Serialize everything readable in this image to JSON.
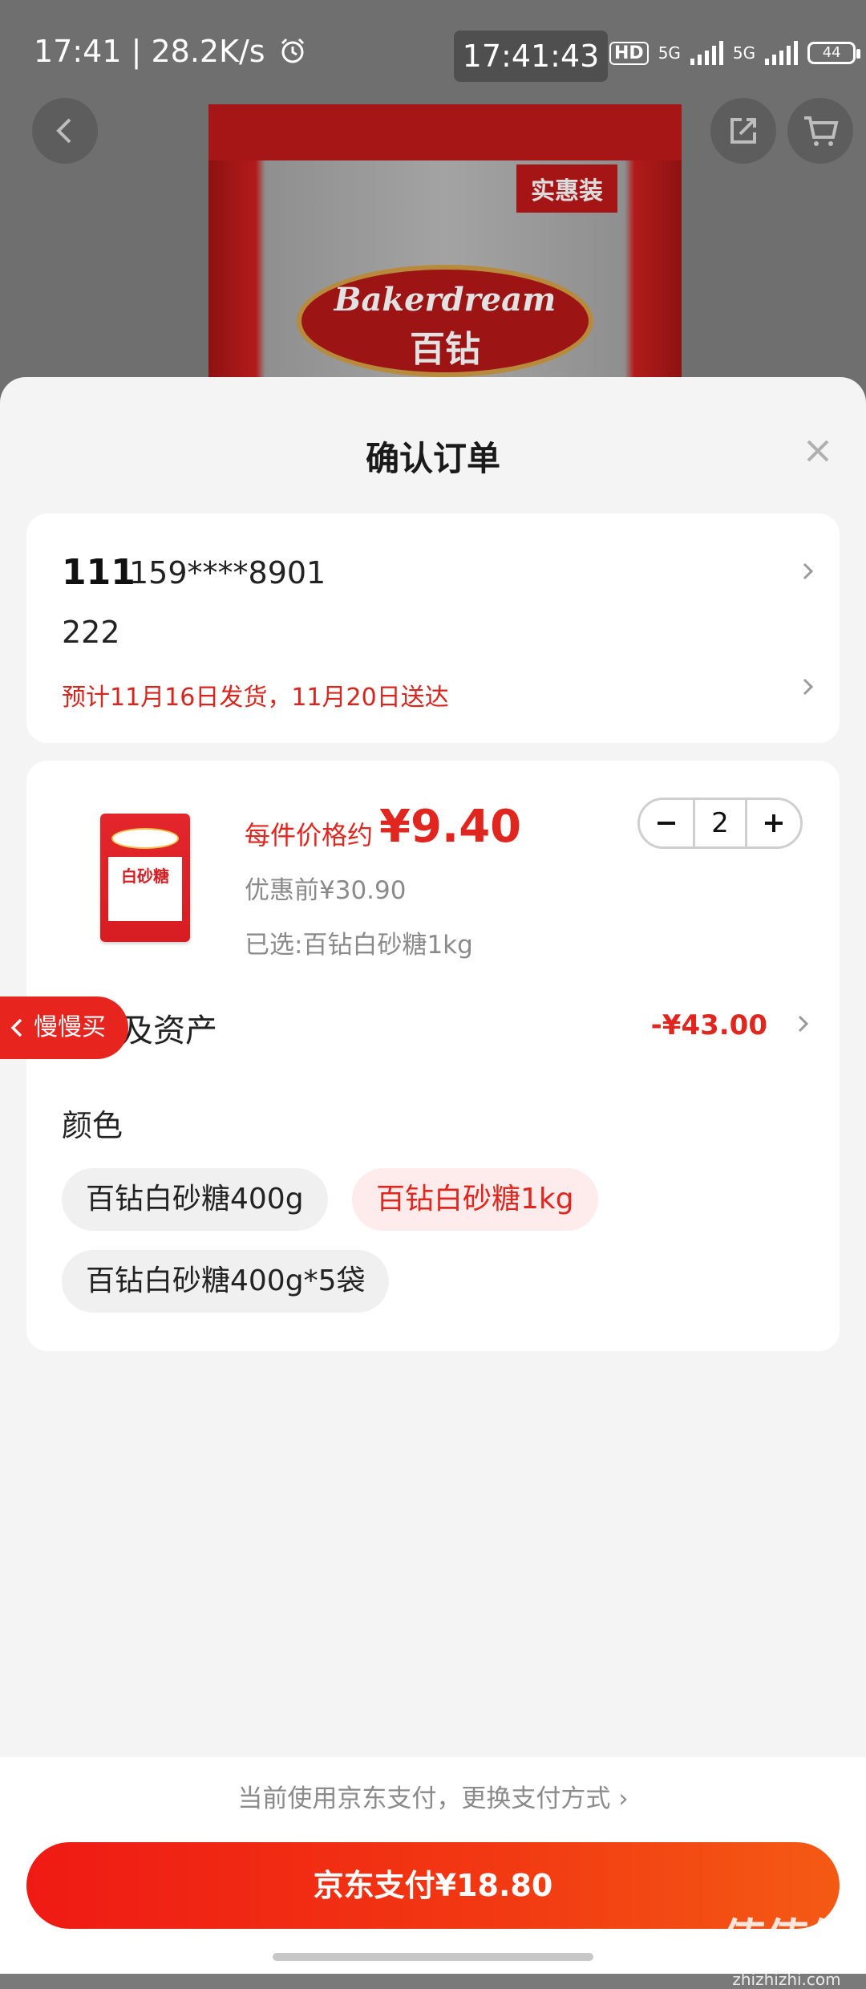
{
  "status_bar": {
    "time_speed": "17:41 | 28.2K/s",
    "center_clock": "17:41:43",
    "net1": "5G",
    "net2": "5G",
    "battery": "44"
  },
  "background": {
    "brand_en": "Bakerdream",
    "brand_cn": "百钻",
    "tag": "实惠装"
  },
  "sheet": {
    "title": "确认订单"
  },
  "address": {
    "name": "111",
    "phone": "159****8901",
    "line": "222",
    "delivery": "预计11月16日发货，11月20日送达"
  },
  "product": {
    "image_text": "白砂糖",
    "price_label": "每件价格约",
    "price": "¥9.40",
    "orig_price": "优惠前¥30.90",
    "selected": "已选:百钻白砂糖1kg",
    "quantity": "2"
  },
  "assets": {
    "label": "及资产",
    "value": "-¥43.00"
  },
  "float_tab": {
    "label": "慢慢买"
  },
  "color": {
    "title": "颜色",
    "options": [
      "百钻白砂糖400g",
      "百钻白砂糖1kg",
      "百钻白砂糖400g*5袋"
    ],
    "selected_index": 1
  },
  "payment": {
    "method_text": "当前使用京东支付，更换支付方式 ›",
    "button": "京东支付¥18.80"
  },
  "watermark": {
    "line1": "值值值",
    "line2": "zhizhizhi.com"
  },
  "colors": {
    "accent": "#e0261e",
    "chip_active_bg": "#fdeceb"
  }
}
